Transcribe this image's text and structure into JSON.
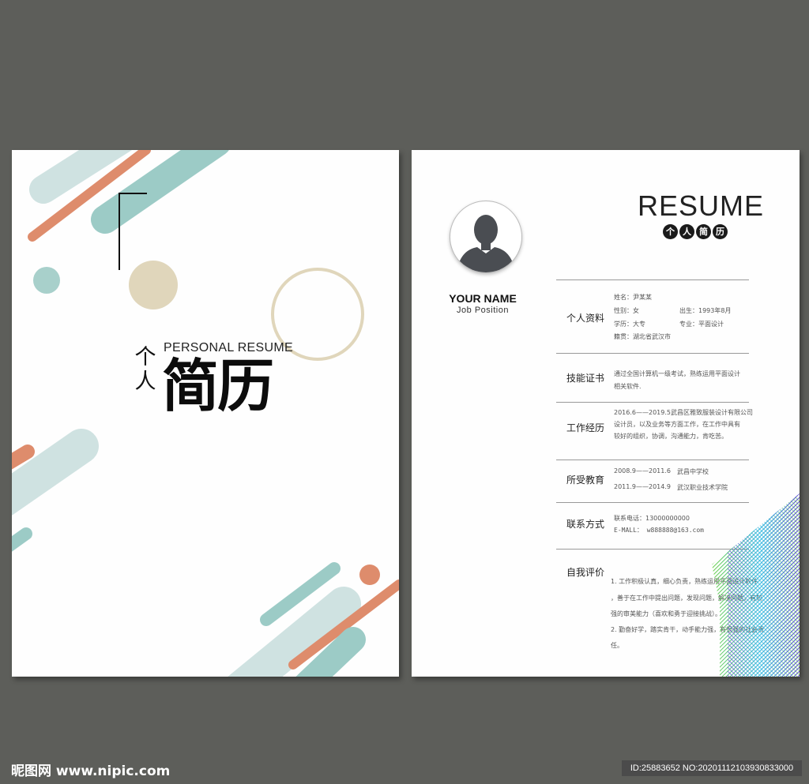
{
  "cover": {
    "title_en": "PERSONAL RESUME",
    "title_small": "个人",
    "title_big": "简历"
  },
  "resume": {
    "title": "RESUME",
    "subtitle_chars": [
      "个",
      "人",
      "简",
      "历"
    ],
    "name": "YOUR NAME",
    "position": "Job Position",
    "sections": {
      "personal_info": {
        "title": "个人资料",
        "name": "姓名：尹某某",
        "gender": "性别：女",
        "birth": "出生：1993年8月",
        "degree": "学历：大专",
        "major": "专业：平面设计",
        "hometown": "籍贯：湖北省武汉市"
      },
      "skills": {
        "title": "技能证书",
        "line1": "通过全国计算机一级考试，熟练运用平面设计",
        "line2": "相关软件."
      },
      "work": {
        "title": "工作经历",
        "line1": "2016.6——2019.5武昌区雅致服装设计有限公司",
        "line2": "设计员，以及业务等方面工作，在工作中具有",
        "line3": "较好的组织，协调，沟通能力，肯吃苦。"
      },
      "education": {
        "title": "所受教育",
        "rows": [
          {
            "period": "2008.9——2011.6",
            "school": "武昌中学校"
          },
          {
            "period": "2011.9——2014.9",
            "school": "武汉职业技术学院"
          }
        ]
      },
      "contact": {
        "title": "联系方式",
        "phone": "联系电话：13000000000",
        "email": "E-MALL： w888888@163.com"
      },
      "self_eval": {
        "title": "自我评价",
        "line1": "1. 工作积极认真，细心负责，熟练运用平面设计软件",
        "line2": "，善于在工作中提出问题，发现问题，解决问题，有较",
        "line3": "强的审美能力（喜欢和勇于迎接挑战）。",
        "line4": "2. 勤奋好学，踏实肯干，动手能力强，有很强的社会责",
        "line5": "任。"
      }
    }
  },
  "footer": {
    "site": "昵图网 www.nipic.com",
    "id_text": "ID:25883652 NO:20201112103930833000"
  },
  "colors": {
    "teal": "#9ccbc6",
    "light_teal": "#cfe2e1",
    "orange": "#de8c6c",
    "beige": "#e0d6bb"
  }
}
